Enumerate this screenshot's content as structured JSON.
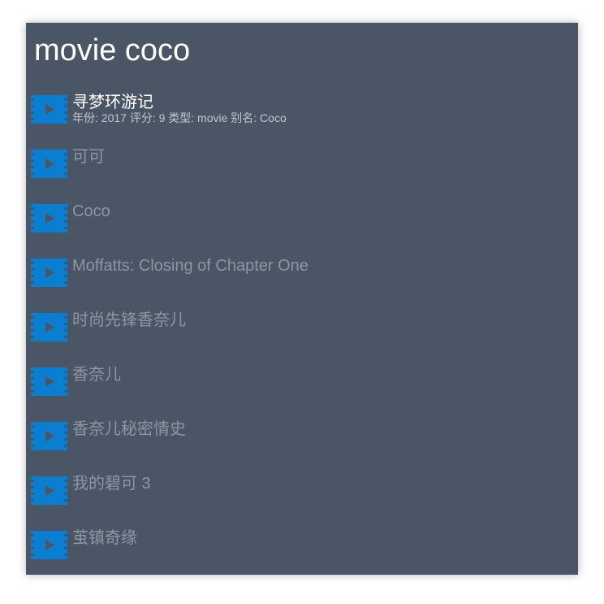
{
  "search": {
    "query": "movie coco"
  },
  "results": [
    {
      "title": "寻梦环游记",
      "subtitle": "年份: 2017 评分: 9 类型: movie 别名: Coco",
      "icon": "film-play-icon",
      "selected": true
    },
    {
      "title": "可可",
      "icon": "film-play-icon"
    },
    {
      "title": "Coco",
      "icon": "film-play-icon"
    },
    {
      "title": "Moffatts: Closing of Chapter One",
      "icon": "film-play-icon"
    },
    {
      "title": "时尚先锋香奈儿",
      "icon": "film-play-icon"
    },
    {
      "title": "香奈儿",
      "icon": "film-play-icon"
    },
    {
      "title": "香奈儿秘密情史",
      "icon": "film-play-icon"
    },
    {
      "title": "我的碧可 3",
      "icon": "film-play-icon"
    },
    {
      "title": "茧镇奇缘",
      "icon": "film-play-icon"
    }
  ],
  "colors": {
    "panel_background": "#4a5565",
    "icon_accent": "#0a7fd1",
    "selected_text": "#ffffff",
    "dim_text": "#8e96a1"
  }
}
